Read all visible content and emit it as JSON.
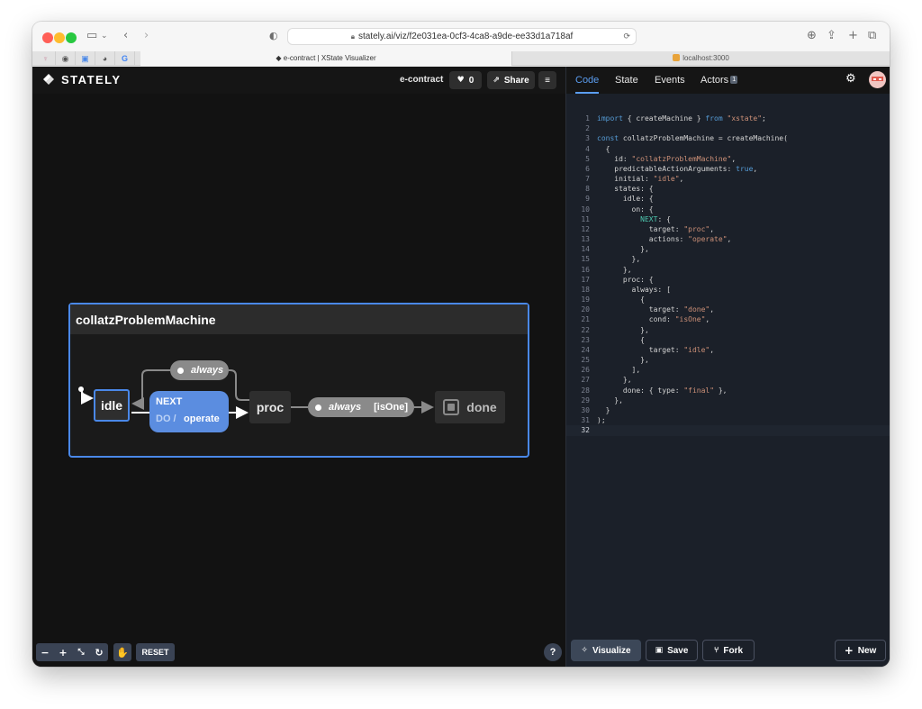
{
  "browser": {
    "url": "stately.ai/viz/f2e031ea-0cf3-4ca8-a9de-ee33d1a718af",
    "tabs": [
      {
        "title": "e-contract | XState Visualizer",
        "active": true
      },
      {
        "title": "localhost:3000",
        "active": false
      }
    ]
  },
  "header": {
    "logo": "STATELY",
    "machine_name": "e-contract",
    "likes": "0",
    "share_label": "Share"
  },
  "machine": {
    "title": "collatzProblemMachine",
    "states": {
      "idle": "idle",
      "proc": "proc",
      "done": "done"
    },
    "transitions": {
      "next_event": "NEXT",
      "next_do": "DO /",
      "next_action": "operate",
      "always_1": "always",
      "always_2": "always",
      "guard": "[isOne]"
    }
  },
  "controls": {
    "reset_label": "RESET",
    "help_label": "?"
  },
  "right_tabs": {
    "code": "Code",
    "state": "State",
    "events": "Events",
    "actors": "Actors",
    "actors_count": "1"
  },
  "code_lines": [
    "import { createMachine } from \"xstate\";",
    "",
    "const collatzProblemMachine = createMachine(",
    "  {",
    "    id: \"collatzProblemMachine\",",
    "    predictableActionArguments: true,",
    "    initial: \"idle\",",
    "    states: {",
    "      idle: {",
    "        on: {",
    "          NEXT: {",
    "            target: \"proc\",",
    "            actions: \"operate\",",
    "          },",
    "        },",
    "      },",
    "      proc: {",
    "        always: [",
    "          {",
    "            target: \"done\",",
    "            cond: \"isOne\",",
    "          },",
    "          {",
    "            target: \"idle\",",
    "          },",
    "        ],",
    "      },",
    "      done: { type: \"final\" },",
    "    },",
    "  }",
    ");",
    ""
  ],
  "bottom_buttons": {
    "visualize": "Visualize",
    "save": "Save",
    "fork": "Fork",
    "new": "New"
  },
  "colors": {
    "accent": "#5b8de0",
    "canvas_bg": "#121212",
    "editor_bg": "#1b2029"
  }
}
